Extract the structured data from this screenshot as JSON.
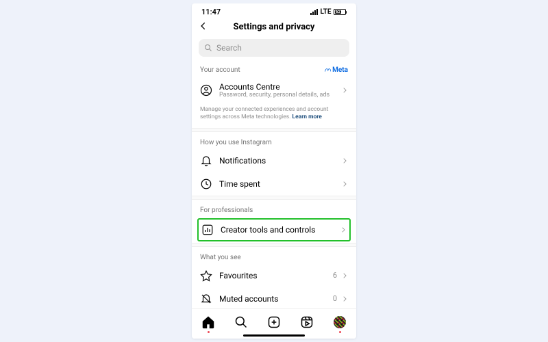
{
  "status": {
    "time": "11:47",
    "net": "LTE",
    "battery": "62"
  },
  "header": {
    "title": "Settings and privacy"
  },
  "search": {
    "placeholder": "Search"
  },
  "sections": {
    "yourAccount": {
      "title": "Your account",
      "brand": "Meta"
    },
    "accountsCentre": {
      "label": "Accounts Centre",
      "sub": "Password, security, personal details, ads"
    },
    "footnote": {
      "text": "Manage your connected experiences and account settings across Meta technologies.",
      "link": "Learn more"
    },
    "howYouUse": {
      "title": "How you use Instagram"
    },
    "notifications": {
      "label": "Notifications"
    },
    "timeSpent": {
      "label": "Time spent"
    },
    "forPros": {
      "title": "For professionals"
    },
    "creatorTools": {
      "label": "Creator tools and controls"
    },
    "whatYouSee": {
      "title": "What you see"
    },
    "favourites": {
      "label": "Favourites",
      "count": "6"
    },
    "muted": {
      "label": "Muted accounts",
      "count": "0"
    }
  }
}
